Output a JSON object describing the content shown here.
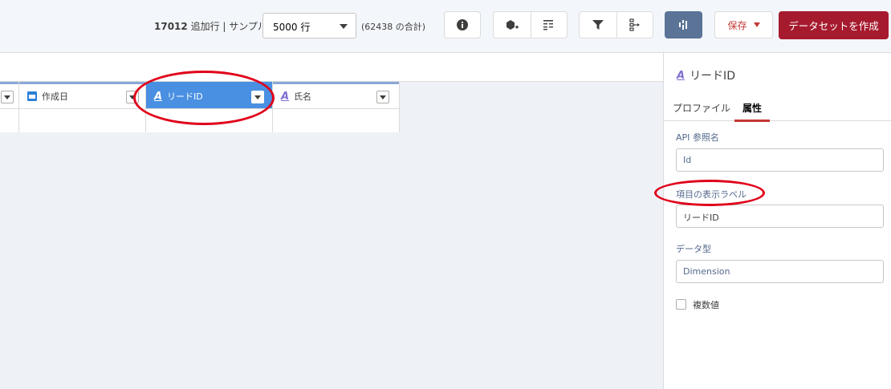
{
  "toolbar": {
    "added_rows": "17012",
    "added_rows_suffix": " 追加行 | ",
    "sample_label": "サンプル:",
    "sample_value": "5000 行",
    "total": "(62438 の合計)",
    "icons": [
      "info-icon",
      "add-node-icon",
      "transform-icon",
      "filter-icon",
      "tree-icon",
      "chart-icon"
    ],
    "save_label": "保存",
    "create_label": "データセットを作成"
  },
  "columns": [
    {
      "label": "",
      "type": "text"
    },
    {
      "label": "作成日",
      "type": "date"
    },
    {
      "label": "リードID",
      "type": "text",
      "selected": true
    },
    {
      "label": "氏名",
      "type": "text"
    }
  ],
  "panel": {
    "title": "リードID",
    "tabs": [
      {
        "label": "プロファイル",
        "active": false
      },
      {
        "label": "属性",
        "active": true
      }
    ],
    "fields": [
      {
        "label": "API 参照名",
        "value": "Id"
      },
      {
        "label": "項目の表示ラベル",
        "value": "リードID"
      },
      {
        "label": "データ型",
        "value": "Dimension"
      }
    ],
    "checkbox_label": "複数値"
  },
  "colors": {
    "accent_red": "#a61a2e",
    "selected_column": "#4a90e2",
    "annotation": "#e0001a"
  }
}
